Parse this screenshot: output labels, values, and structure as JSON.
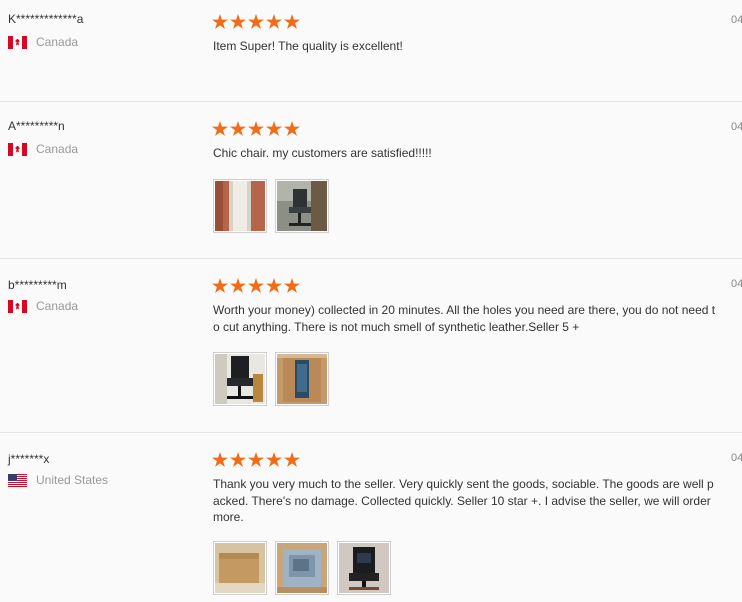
{
  "reviews": [
    {
      "user": "K*************a",
      "country": "Canada",
      "flag": "ca",
      "rating": 5,
      "text": "Item Super! The quality is excellent!",
      "date": "04",
      "photos": []
    },
    {
      "user": "A*********n",
      "country": "Canada",
      "flag": "ca",
      "rating": 5,
      "text": "Chic chair. my customers are satisfied!!!!!",
      "date": "04",
      "photos": [
        "hallway-photo",
        "office-chair-photo"
      ]
    },
    {
      "user": "b*********m",
      "country": "Canada",
      "flag": "ca",
      "rating": 5,
      "text": "Worth your money) collected in 20 minutes. All the holes you need are there, you do not need to cut anything. There is not much smell of synthetic leather.Seller 5 +",
      "date": "04",
      "photos": [
        "assembled-chair-photo",
        "chair-in-box-photo"
      ]
    },
    {
      "user": "j*******x",
      "country": "United States",
      "flag": "us",
      "rating": 5,
      "text": "Thank you very much to the seller. Very quickly sent the goods, sociable. The goods are well packed. There's no damage. Collected quickly. Seller 10 star +. I advise the seller, we will order more.",
      "date": "04",
      "photos": [
        "cardboard-box-photo",
        "packed-parts-photo",
        "dark-chair-photo"
      ]
    }
  ]
}
